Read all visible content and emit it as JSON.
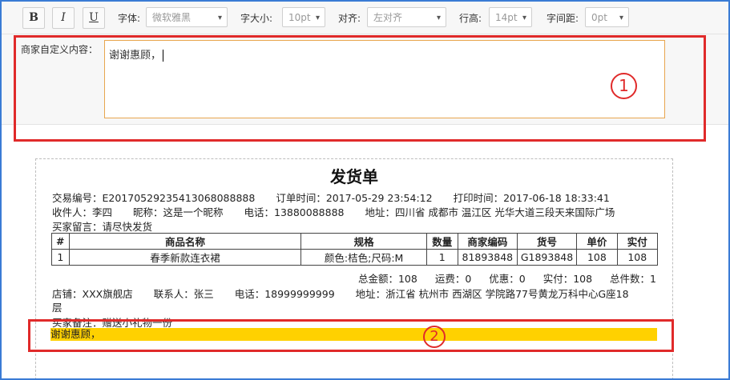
{
  "toolbar": {
    "bold": "B",
    "italic": "I",
    "underline": "U",
    "font_label": "字体:",
    "font_value": "微软雅黑",
    "size_label": "字大小:",
    "size_value": "10pt",
    "align_label": "对齐:",
    "align_value": "左对齐",
    "lineheight_label": "行高:",
    "lineheight_value": "14pt",
    "spacing_label": "字间距:",
    "spacing_value": "0pt"
  },
  "editor": {
    "label": "商家自定义内容：",
    "value": "谢谢惠顾，"
  },
  "callouts": {
    "one": "1",
    "two": "2"
  },
  "invoice": {
    "title": "发货单",
    "trade_no": "交易编号：E20170529235413068088888",
    "order_time": "订单时间：2017-05-29 23:54:12",
    "print_time": "打印时间：2017-06-18 18:33:41",
    "recipient": "收件人：李四",
    "nickname": "昵称：这是一个昵称",
    "phone": "电话：13880088888",
    "address": "地址：四川省 成都市 温江区 光华大道三段天来国际广场",
    "buyer_msg": "买家留言：请尽快发货",
    "columns": [
      "#",
      "商品名称",
      "规格",
      "数量",
      "商家编码",
      "货号",
      "单价",
      "实付"
    ],
    "rows": [
      [
        "1",
        "春季新款连衣裙",
        "颜色:桔色;尺码:M",
        "1",
        "81893848",
        "G1893848",
        "108",
        "108"
      ]
    ],
    "totals": [
      "总金额：108",
      "运费：0",
      "优惠：0",
      "实付：108",
      "总件数：1"
    ],
    "shop": "店铺：XXX旗舰店",
    "contact": "联系人：张三",
    "shop_phone": "电话：18999999999",
    "shop_address": "地址：浙江省 杭州市 西湖区 学院路77号黄龙万科中心G座18层",
    "buyer_note": "买家备注：赠送小礼物一份",
    "custom_content": "谢谢惠顾，"
  },
  "colors": {
    "accent_border": "#3a7bd5",
    "callout": "#e02a2a",
    "highlight": "#ffd100",
    "input_focus": "#e8a64f"
  }
}
